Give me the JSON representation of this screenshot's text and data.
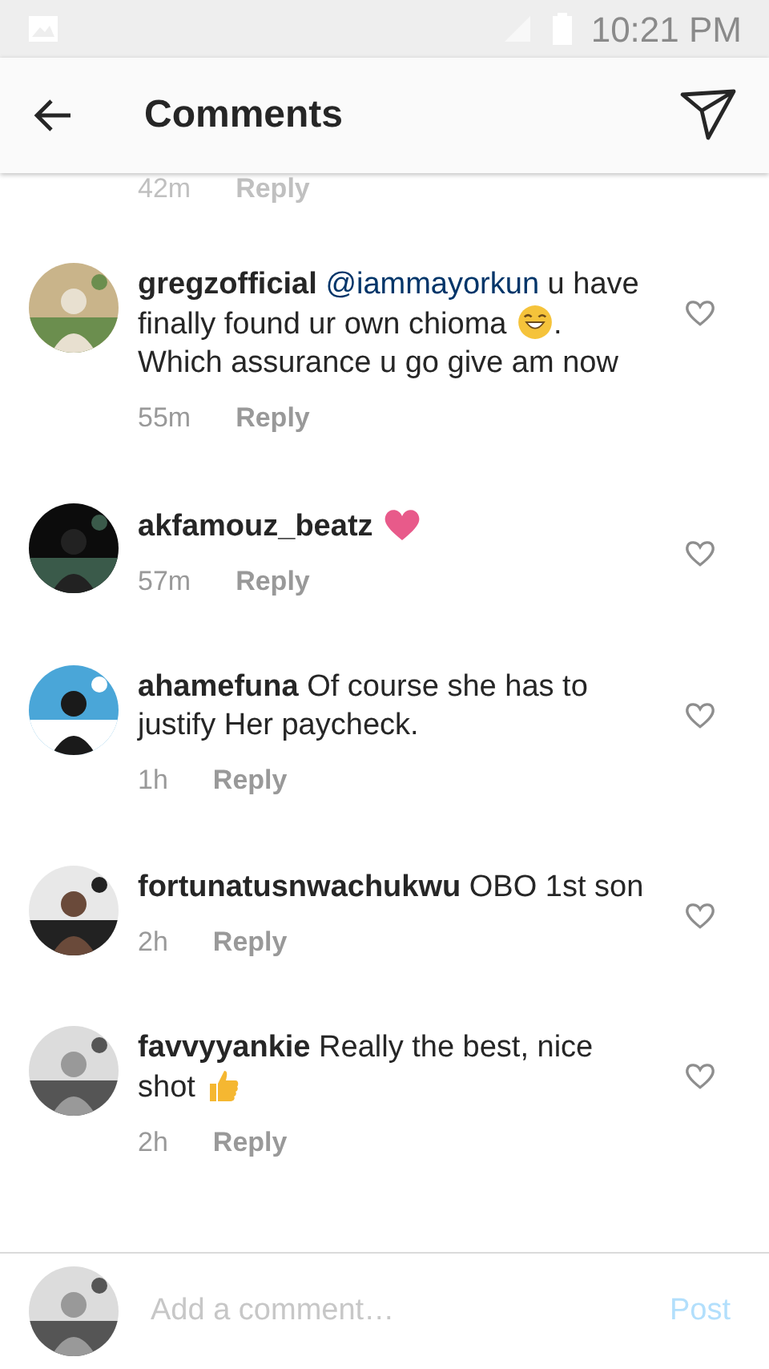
{
  "status_bar": {
    "time": "10:21 PM"
  },
  "header": {
    "title": "Comments"
  },
  "cut_off_comment": {
    "time": "42m",
    "reply": "Reply"
  },
  "comments": [
    {
      "username": "gregzofficial",
      "body": [
        {
          "kind": "mention",
          "text": "@iammayorkun"
        },
        {
          "kind": "text",
          "text": " u have finally found ur own chioma "
        },
        {
          "kind": "laugh_emoji"
        },
        {
          "kind": "text",
          "text": ". Which assurance u go give am now"
        }
      ],
      "time": "55m",
      "reply": "Reply",
      "liked": false
    },
    {
      "username": "akfamouz_beatz",
      "body": [
        {
          "kind": "heart_emoji"
        }
      ],
      "time": "57m",
      "reply": "Reply",
      "liked": false
    },
    {
      "username": "ahamefuna",
      "body": [
        {
          "kind": "text",
          "text": " Of course she has to justify Her paycheck."
        }
      ],
      "time": "1h",
      "reply": "Reply",
      "liked": false
    },
    {
      "username": "fortunatusnwachukwu",
      "body": [
        {
          "kind": "text",
          "text": " OBO 1st son"
        }
      ],
      "time": "2h",
      "reply": "Reply",
      "liked": false
    },
    {
      "username": "favvyyankie",
      "body": [
        {
          "kind": "text",
          "text": " Really the best, nice shot"
        },
        {
          "kind": "thumbs_emoji"
        }
      ],
      "time": "2h",
      "reply": "Reply",
      "liked": false
    }
  ],
  "composer": {
    "placeholder": "Add a comment…",
    "post": "Post",
    "post_disabled": true
  }
}
